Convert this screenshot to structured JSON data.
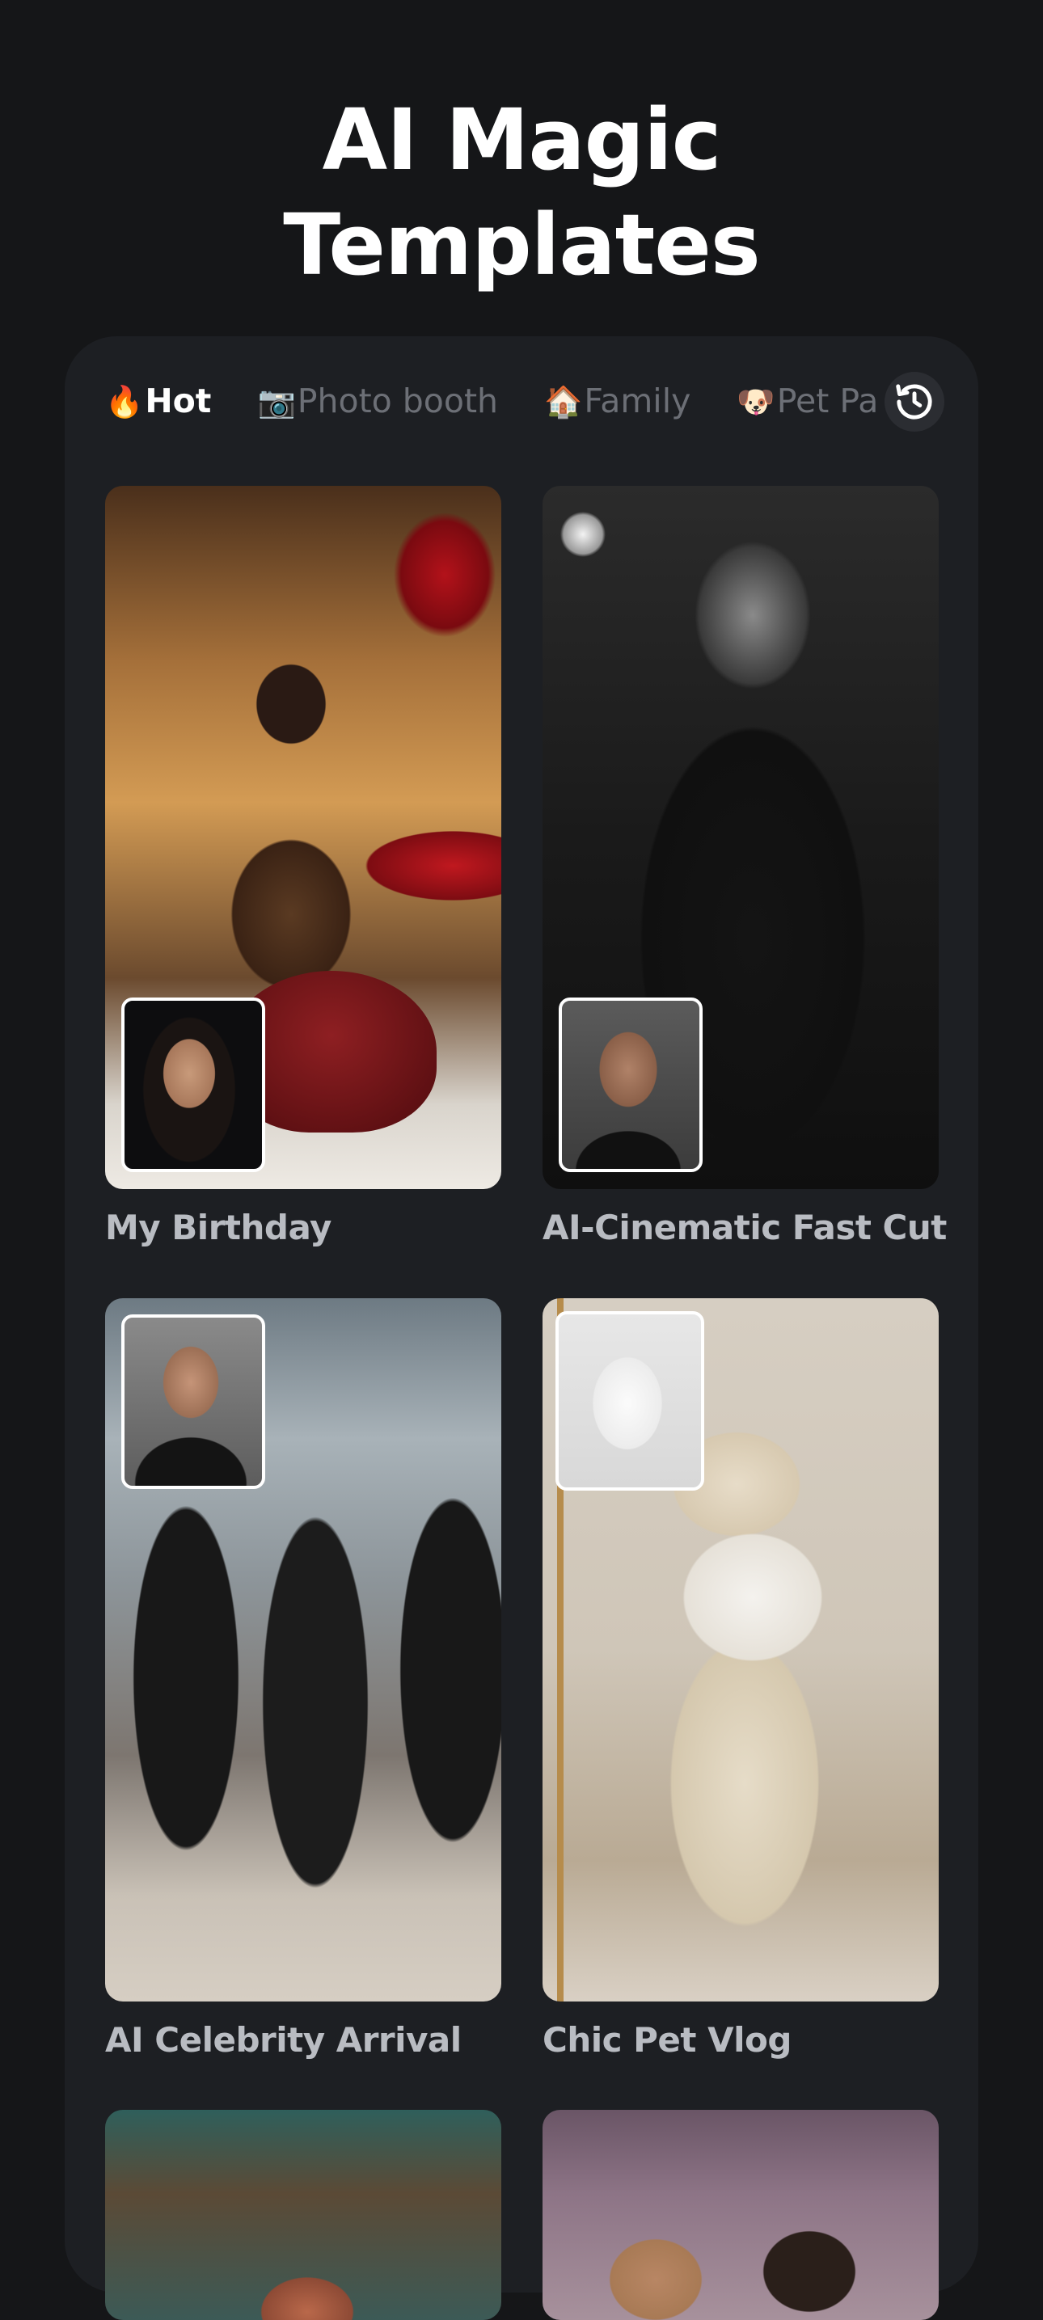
{
  "title": {
    "line1": "AI Magic",
    "line2": "Templates"
  },
  "tabs": [
    {
      "emoji": "🔥",
      "label": "Hot",
      "active": true
    },
    {
      "emoji": "📷",
      "label": "Photo booth",
      "active": false
    },
    {
      "emoji": "🏠",
      "label": "Family",
      "active": false
    },
    {
      "emoji": "🐶",
      "label": "Pet Pa",
      "active": false
    }
  ],
  "history_icon": "history-clock-icon",
  "templates": [
    {
      "label": "My Birthday"
    },
    {
      "label": "AI-Cinematic Fast Cut"
    },
    {
      "label": "AI Celebrity Arrival"
    },
    {
      "label": "Chic Pet Vlog"
    }
  ],
  "colors": {
    "background": "#151618",
    "panel": "#1d1f23",
    "active_tab": "#ffffff",
    "inactive_tab": "#6c6f76",
    "card_label": "#b9bcc2"
  }
}
